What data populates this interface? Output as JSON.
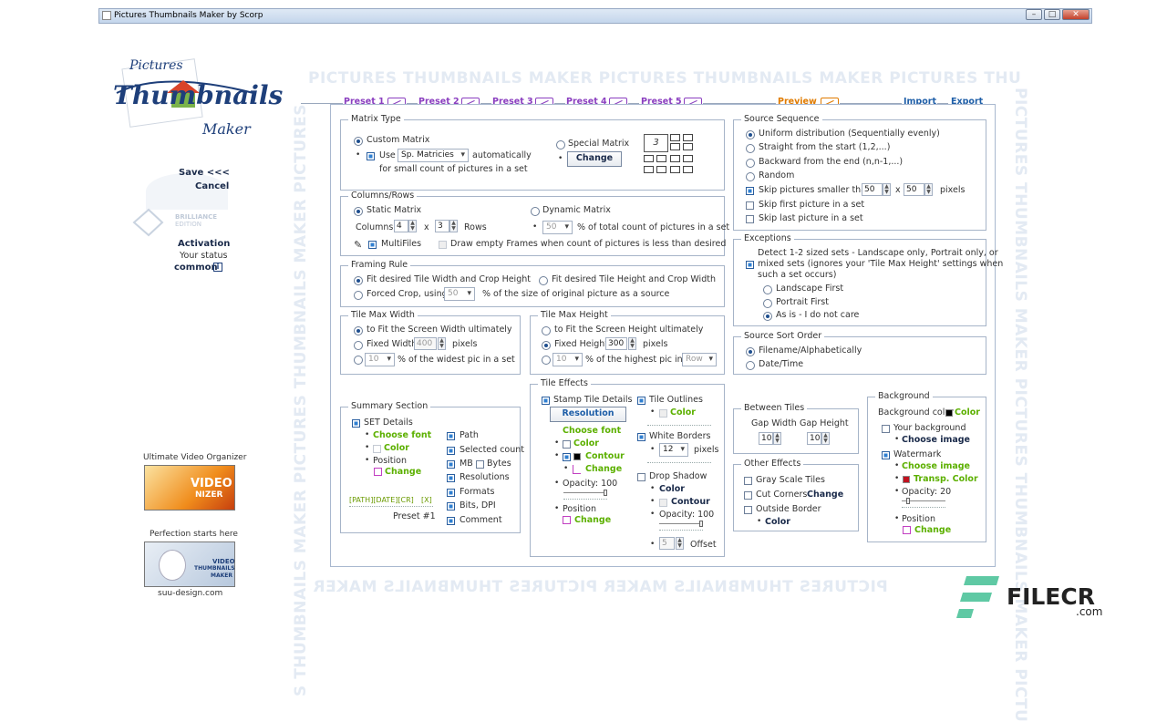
{
  "window": {
    "title": "Pictures Thumbnails Maker by Scorp"
  },
  "watermark": {
    "text": "PICTURES THUMBNAILS MAKER PICTURES THUMBNAILS MAKER PICTURES THU",
    "bottom_text": "PICTURES THUMBNAILS MAKER PICTURES THUMBNAILS MAKER",
    "side_text": "PICTURES THUMBNAILS MAKER PICTURES THUMBNAILS MAKER PICTU",
    "left_side_text": "S THUMBNAILS MAKER PICTURES THUMBNAILS MAKER PICTURES"
  },
  "logo": {
    "line1": "Pictures",
    "line2": "Thumbnails",
    "line3": "Maker"
  },
  "sidebar": {
    "save": "Save <<<",
    "cancel": "Cancel",
    "edition": "BRILLIANCE",
    "edition2": "EDITION",
    "activation": "Activation",
    "status_label": "Your status",
    "status_value": "common",
    "promo1_title": "Ultimate Video Organizer",
    "promo1_img": "VIDEO",
    "promo1_img2": "NIZER",
    "promo2_title": "Perfection starts here",
    "promo2_img": "VIDEO",
    "promo2_img2": "THUMBNAILS",
    "promo2_img3": "MAKER",
    "site": "suu-design.com"
  },
  "presets": {
    "p1": "Preset 1",
    "p2": "Preset 2",
    "p3": "Preset 3",
    "p4": "Preset 4",
    "p5": "Preset 5",
    "preview": "Preview",
    "import": "Import",
    "export": "Export"
  },
  "matrix_type": {
    "title": "Matrix Type",
    "custom": "Custom Matrix",
    "use": "Use",
    "sp_value": "Sp. Matricies",
    "auto": "automatically",
    "small": "for small count of pictures in a set",
    "special": "Special Matrix",
    "change": "Change",
    "num": "3"
  },
  "columns_rows": {
    "title": "Columns/Rows",
    "static": "Static Matrix",
    "columns": "Columns",
    "columns_val": "4",
    "x": "x",
    "rows_val": "3",
    "rows": "Rows",
    "dynamic": "Dynamic Matrix",
    "dyn_val": "50",
    "dyn_text": "% of total count of pictures in a set",
    "multifiles": "MultiFiles",
    "draw_empty": "Draw empty Frames when count of pictures is less than desired"
  },
  "framing": {
    "title": "Framing Rule",
    "opt1": "Fit desired Tile Width and Crop Height",
    "opt2": "Fit desired Tile Height and Crop Width",
    "opt3": "Forced Crop, using",
    "crop_val": "50",
    "crop_text": "% of the size of original picture as a source"
  },
  "tile_width": {
    "title": "Tile Max Width",
    "opt1": "to Fit the Screen Width ultimately",
    "opt2": "Fixed Width",
    "fixed_val": "400",
    "pixels": "pixels",
    "pct_val": "10",
    "pct_text": "% of the widest pic in a set"
  },
  "tile_height": {
    "title": "Tile Max Height",
    "opt1": "to Fit the Screen Height ultimately",
    "opt2": "Fixed Height",
    "fixed_val": "300",
    "pixels": "pixels",
    "pct_val": "10",
    "pct_text": "% of the highest pic in a",
    "row_val": "Row"
  },
  "summary": {
    "title": "Summary Section",
    "set_details": "SET Details",
    "choose_font": "Choose font",
    "color": "Color",
    "position": "Position",
    "change": "Change",
    "path": "Path",
    "selected": "Selected count",
    "mb": "MB",
    "bytes": "Bytes",
    "resolutions": "Resolutions",
    "formats": "Formats",
    "bits": "Bits, DPI",
    "comment": "Comment",
    "tags": "[PATH][DATE][CR]",
    "x": "[X]",
    "preset": "Preset #1"
  },
  "tile_effects": {
    "title": "Tile Effects",
    "stamp": "Stamp Tile Details",
    "resolution": "Resolution",
    "choose_font": "Choose font",
    "color": "Color",
    "contour": "Contour",
    "change": "Change",
    "opacity": "Opacity: 100",
    "position": "Position",
    "change2": "Change",
    "outlines": "Tile Outlines",
    "outline_color": "Color",
    "white_borders": "White Borders",
    "wb_val": "12",
    "pixels": "pixels",
    "drop_shadow": "Drop Shadow",
    "ds_color": "Color",
    "ds_contour": "Contour",
    "ds_opacity": "Opacity: 100",
    "offset_val": "5",
    "offset": "Offset"
  },
  "source_seq": {
    "title": "Source Sequence",
    "opt1": "Uniform distribution (Sequentially evenly)",
    "opt2": "Straight from the start (1,2,...)",
    "opt3": "Backward from the end (n,n-1,...)",
    "opt4": "Random",
    "skip_small": "Skip pictures smaller than",
    "w": "50",
    "x": "x",
    "h": "50",
    "pixels": "pixels",
    "skip_first": "Skip first picture in a set",
    "skip_last": "Skip last picture in a set"
  },
  "exceptions": {
    "title": "Exceptions",
    "line1": "Detect 1-2 sized sets - Landscape only, Portrait only, or",
    "line2": "mixed sets (ignores your 'Tile Max Height' settings when",
    "line3": "such a set occurs)",
    "landscape": "Landscape First",
    "portrait": "Portrait First",
    "asis": "As is - I do not care"
  },
  "sort": {
    "title": "Source Sort Order",
    "opt1": "Filename/Alphabetically",
    "opt2": "Date/Time"
  },
  "between": {
    "title": "Between Tiles",
    "gap_w": "Gap Width",
    "gap_h": "Gap Height",
    "gw_val": "10",
    "gh_val": "10"
  },
  "other": {
    "title": "Other Effects",
    "gray": "Gray Scale Tiles",
    "cut": "Cut Corners",
    "change": "Change",
    "outside": "Outside Border",
    "color": "Color"
  },
  "background": {
    "title": "Background",
    "bgcolor": "Background color",
    "color": "Color",
    "yourbg": "Your background",
    "choose_image": "Choose image",
    "watermark": "Watermark",
    "wm_choose": "Choose image",
    "transp": "Transp. Color",
    "opacity": "Opacity: 20",
    "position": "Position",
    "change": "Change"
  },
  "filecr": {
    "text": "FILECR",
    "sub": ".com"
  },
  "colors": {
    "accent_purple": "#8b3fc0",
    "accent_orange": "#e07b00",
    "accent_blue": "#1f5fa8",
    "green": "#5cb000"
  }
}
